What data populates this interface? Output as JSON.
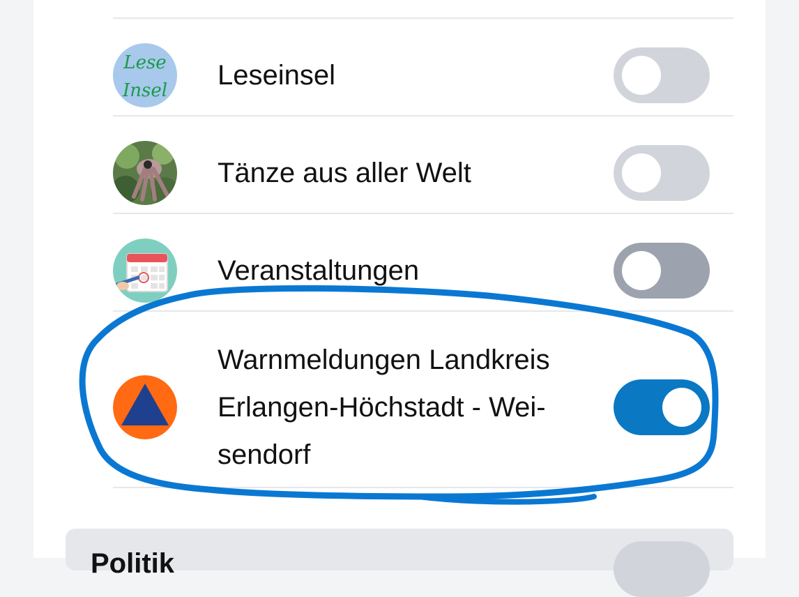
{
  "channels": [
    {
      "label": "Leseinsel",
      "avatar_icon": "leseinsel-logo",
      "avatar_text": [
        "Lese",
        "Insel"
      ],
      "enabled": false
    },
    {
      "label": "Tänze aus aller Welt",
      "avatar_icon": "dance-photo",
      "enabled": false
    },
    {
      "label": "Veranstaltungen",
      "avatar_icon": "calendar-icon",
      "enabled": false
    },
    {
      "label": "Warnmeldungen Landkreis Erlangen-Höchstadt - Wei-sendorf",
      "label_lines": [
        "Warnmeldungen Landkreis",
        "Erlangen-Höchstadt - Wei-",
        "sendorf"
      ],
      "avatar_icon": "civil-protection-icon",
      "enabled": true
    }
  ],
  "bottom_section": {
    "label": "Politik",
    "enabled": false
  },
  "colors": {
    "toggle_on": "#0a78c2",
    "toggle_off": "#d1d5db",
    "annotation": "#0a78d2",
    "civil_protection_orange": "#ff6a13",
    "civil_protection_blue": "#1f3f8f"
  }
}
